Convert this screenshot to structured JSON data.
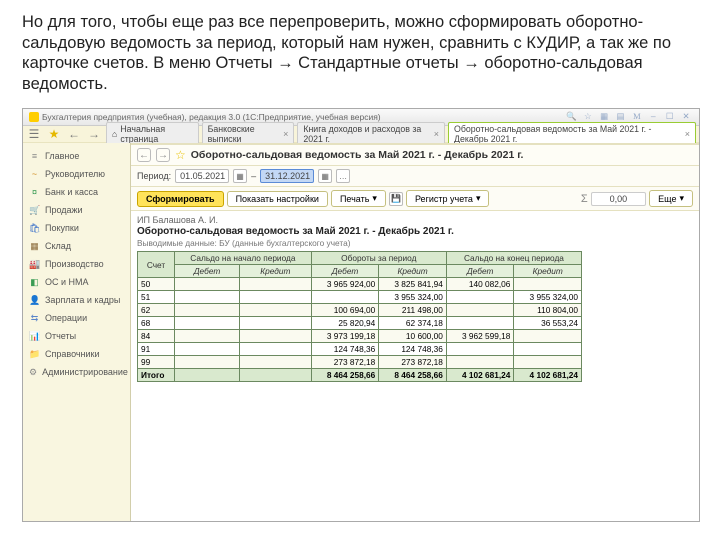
{
  "intro_text": "Но для того, чтобы еще раз все перепроверить, можно сформировать оборотно-сальдовую ведомость за период, который нам нужен, сравнить с КУДИР, а так же по карточке счетов. В меню Отчеты → Стандартные отчеты → оборотно-сальдовая ведомость.",
  "window_title": "Бухгалтерия предприятия (учебная), редакция 3.0  (1С:Предприятие, учебная версия)",
  "tabs": [
    {
      "label": "Начальная страница",
      "home": true
    },
    {
      "label": "Банковские выписки",
      "home": false
    },
    {
      "label": "Книга доходов и расходов за 2021 г.",
      "home": false
    },
    {
      "label": "Оборотно-сальдовая ведомость за Май 2021 г. - Декабрь 2021 г.",
      "home": false,
      "active": true
    }
  ],
  "sidebar": [
    {
      "icon": "≡",
      "color": "#888",
      "label": "Главное"
    },
    {
      "icon": "~",
      "color": "#d08b1e",
      "label": "Руководителю"
    },
    {
      "icon": "¤",
      "color": "#3a9c54",
      "label": "Банк и касса"
    },
    {
      "icon": "🛒",
      "color": "#c94a4a",
      "label": "Продажи"
    },
    {
      "icon": "🛍",
      "color": "#3a70c9",
      "label": "Покупки"
    },
    {
      "icon": "▦",
      "color": "#8a6a3a",
      "label": "Склад"
    },
    {
      "icon": "🏭",
      "color": "#777",
      "label": "Производство"
    },
    {
      "icon": "◧",
      "color": "#3a9c54",
      "label": "ОС и НМА"
    },
    {
      "icon": "👤",
      "color": "#888",
      "label": "Зарплата и кадры"
    },
    {
      "icon": "⇆",
      "color": "#5a85c9",
      "label": "Операции"
    },
    {
      "icon": "📊",
      "color": "#d0911e",
      "label": "Отчеты"
    },
    {
      "icon": "📁",
      "color": "#d08b1e",
      "label": "Справочники"
    },
    {
      "icon": "⚙",
      "color": "#888",
      "label": "Администрирование"
    }
  ],
  "doc_title": "Оборотно-сальдовая ведомость за Май 2021 г. - Декабрь 2021 г.",
  "period": {
    "label": "Период:",
    "from": "01.05.2021",
    "to": "31.12.2021"
  },
  "actions": {
    "form": "Сформировать",
    "settings": "Показать настройки",
    "print": "Печать",
    "reg": "Регистр учета",
    "more": "Еще",
    "sum": "0,00"
  },
  "report": {
    "org": "ИП Балашова А. И.",
    "title": "Оборотно-сальдовая ведомость за Май 2021 г. - Декабрь 2021 г.",
    "sub": "Выводимые данные: БУ (данные бухгалтерского учета)",
    "headers": {
      "acct": "Счет",
      "h1": "Сальдо на начало периода",
      "h2": "Обороты за период",
      "h3": "Сальдо на конец периода",
      "d": "Дебет",
      "c": "Кредит",
      "total": "Итого"
    }
  },
  "chart_data": {
    "type": "table",
    "columns": [
      "Счет",
      "Сальдо нач. Дебет",
      "Сальдо нач. Кредит",
      "Обороты Дебет",
      "Обороты Кредит",
      "Сальдо кон. Дебет",
      "Сальдо кон. Кредит"
    ],
    "rows": [
      {
        "acct": "50",
        "sd": "",
        "sc": "",
        "od": "3 965 924,00",
        "oc": "3 825 841,94",
        "ed": "140 082,06",
        "ec": ""
      },
      {
        "acct": "51",
        "sd": "",
        "sc": "",
        "od": "",
        "oc": "3 955 324,00",
        "ed": "",
        "ec": "3 955 324,00"
      },
      {
        "acct": "62",
        "sd": "",
        "sc": "",
        "od": "100 694,00",
        "oc": "211 498,00",
        "ed": "",
        "ec": "110 804,00"
      },
      {
        "acct": "68",
        "sd": "",
        "sc": "",
        "od": "25 820,94",
        "oc": "62 374,18",
        "ed": "",
        "ec": "36 553,24"
      },
      {
        "acct": "84",
        "sd": "",
        "sc": "",
        "od": "3 973 199,18",
        "oc": "10 600,00",
        "ed": "3 962 599,18",
        "ec": ""
      },
      {
        "acct": "91",
        "sd": "",
        "sc": "",
        "od": "124 748,36",
        "oc": "124 748,36",
        "ed": "",
        "ec": ""
      },
      {
        "acct": "99",
        "sd": "",
        "sc": "",
        "od": "273 872,18",
        "oc": "273 872,18",
        "ed": "",
        "ec": ""
      }
    ],
    "total": {
      "od": "8 464 258,66",
      "oc": "8 464 258,66",
      "ed": "4 102 681,24",
      "ec": "4 102 681,24"
    }
  }
}
